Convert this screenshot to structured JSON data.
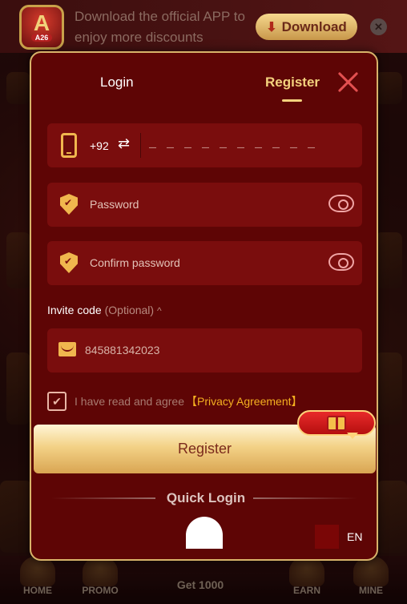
{
  "banner": {
    "logo_text": "A",
    "logo_tag": "A26",
    "message": "Download the official APP to enjoy more discounts",
    "download_label": "Download",
    "close_glyph": "✕"
  },
  "modal": {
    "tabs": {
      "login": "Login",
      "register": "Register"
    },
    "phone": {
      "country_code": "+92",
      "swap_glyph": "⇄",
      "placeholder": "_ _ _ _ _ _ _ _ _ _"
    },
    "password": {
      "placeholder": "Password"
    },
    "confirm_password": {
      "placeholder": "Confirm password"
    },
    "invite": {
      "title": "Invite code",
      "optional": "(Optional)",
      "caret": "^",
      "value": "845881342023"
    },
    "agreement": {
      "checked": true,
      "check_glyph": "✔",
      "text": "I have read and agree",
      "link": "【Privacy Agreement】"
    },
    "register_button": "Register",
    "quick_login": "Quick Login",
    "language": "EN"
  },
  "bottom_nav": {
    "items": [
      "HOME",
      "PROMO",
      "EARN",
      "MINE"
    ],
    "center_text": "Get 1000"
  },
  "colors": {
    "modal_bg": "#5e0505",
    "field_bg": "#7a0d0d",
    "accent_gold": "#f4d27e",
    "close_red": "#e35050",
    "link_orange": "#f4b020"
  }
}
